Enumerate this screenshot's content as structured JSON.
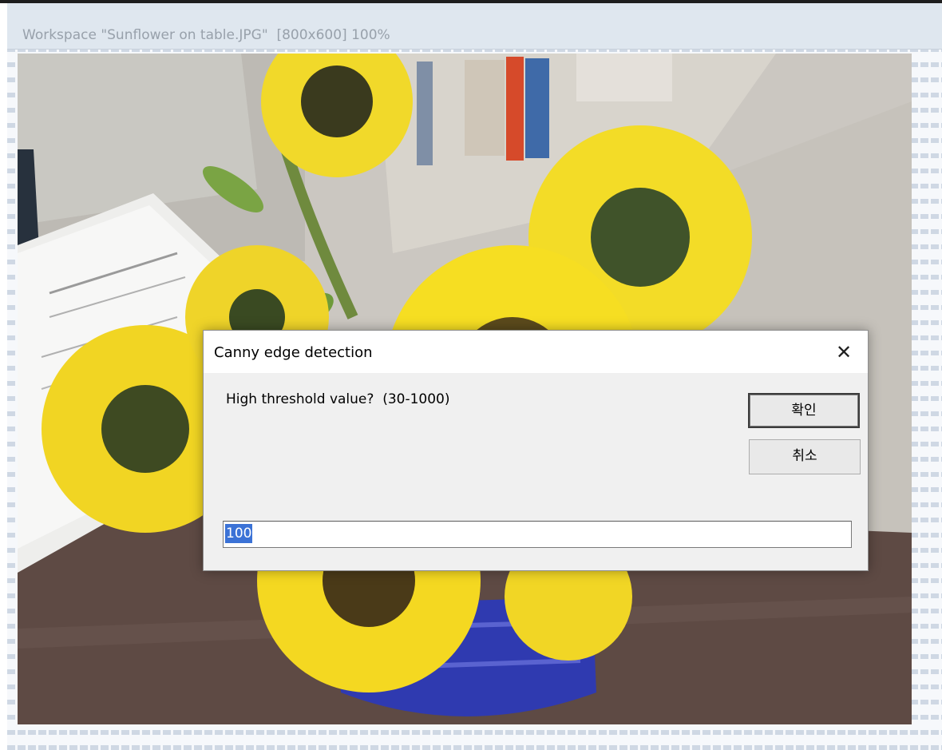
{
  "window": {
    "title": "Workspace \"Sunflower on table.JPG\"  [800x600] 100%"
  },
  "dialog": {
    "title": "Canny edge detection",
    "prompt": "High threshold value?  (30-1000)",
    "ok_label": "확인",
    "cancel_label": "취소",
    "input_value": "100",
    "close_icon": "close-icon"
  },
  "colors": {
    "selection": "#3b72d6",
    "dialog_bg": "#f0f0f0",
    "workspace_pattern": "#cfd8e4"
  }
}
